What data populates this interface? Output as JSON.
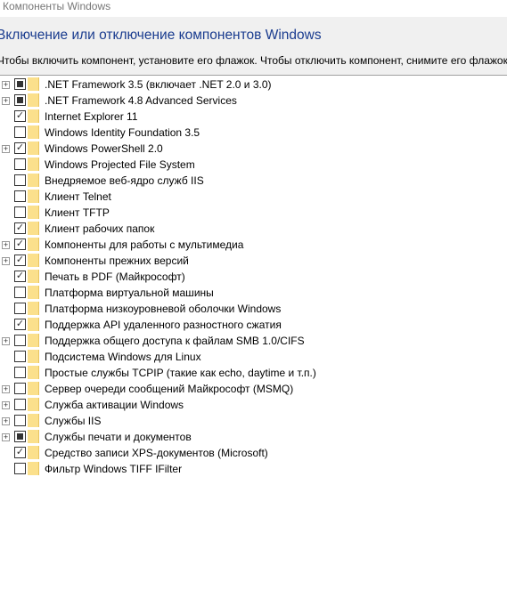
{
  "window": {
    "title": "Компоненты Windows"
  },
  "header": {
    "heading": "Включение или отключение компонентов Windows",
    "instruction": "Чтобы включить компонент, установите его флажок. Чтобы отключить компонент, снимите его флажок."
  },
  "features": [
    {
      "label": ".NET Framework 3.5 (включает .NET 2.0 и 3.0)",
      "state": "partial",
      "expandable": true
    },
    {
      "label": ".NET Framework 4.8 Advanced Services",
      "state": "partial",
      "expandable": true
    },
    {
      "label": "Internet Explorer 11",
      "state": "checked",
      "expandable": false
    },
    {
      "label": "Windows Identity Foundation 3.5",
      "state": "unchecked",
      "expandable": false
    },
    {
      "label": "Windows PowerShell 2.0",
      "state": "checked",
      "expandable": true
    },
    {
      "label": "Windows Projected File System",
      "state": "unchecked",
      "expandable": false
    },
    {
      "label": "Внедряемое веб-ядро служб IIS",
      "state": "unchecked",
      "expandable": false
    },
    {
      "label": "Клиент Telnet",
      "state": "unchecked",
      "expandable": false
    },
    {
      "label": "Клиент TFTP",
      "state": "unchecked",
      "expandable": false
    },
    {
      "label": "Клиент рабочих папок",
      "state": "checked",
      "expandable": false
    },
    {
      "label": "Компоненты для работы с мультимедиа",
      "state": "checked",
      "expandable": true
    },
    {
      "label": "Компоненты прежних версий",
      "state": "checked",
      "expandable": true
    },
    {
      "label": "Печать в PDF (Майкрософт)",
      "state": "checked",
      "expandable": false
    },
    {
      "label": "Платформа виртуальной машины",
      "state": "unchecked",
      "expandable": false
    },
    {
      "label": "Платформа низкоуровневой оболочки Windows",
      "state": "unchecked",
      "expandable": false
    },
    {
      "label": "Поддержка API удаленного разностного сжатия",
      "state": "checked",
      "expandable": false
    },
    {
      "label": "Поддержка общего доступа к файлам SMB 1.0/CIFS",
      "state": "unchecked",
      "expandable": true
    },
    {
      "label": "Подсистема Windows для Linux",
      "state": "unchecked",
      "expandable": false
    },
    {
      "label": "Простые службы TCPIP (такие как echo, daytime и т.п.)",
      "state": "unchecked",
      "expandable": false
    },
    {
      "label": "Сервер очереди сообщений Майкрософт (MSMQ)",
      "state": "unchecked",
      "expandable": true
    },
    {
      "label": "Служба активации Windows",
      "state": "unchecked",
      "expandable": true
    },
    {
      "label": "Службы IIS",
      "state": "unchecked",
      "expandable": true
    },
    {
      "label": "Службы печати и документов",
      "state": "partial",
      "expandable": true
    },
    {
      "label": "Средство записи XPS-документов (Microsoft)",
      "state": "checked",
      "expandable": false
    },
    {
      "label": "Фильтр Windows TIFF IFilter",
      "state": "unchecked",
      "expandable": false
    }
  ]
}
